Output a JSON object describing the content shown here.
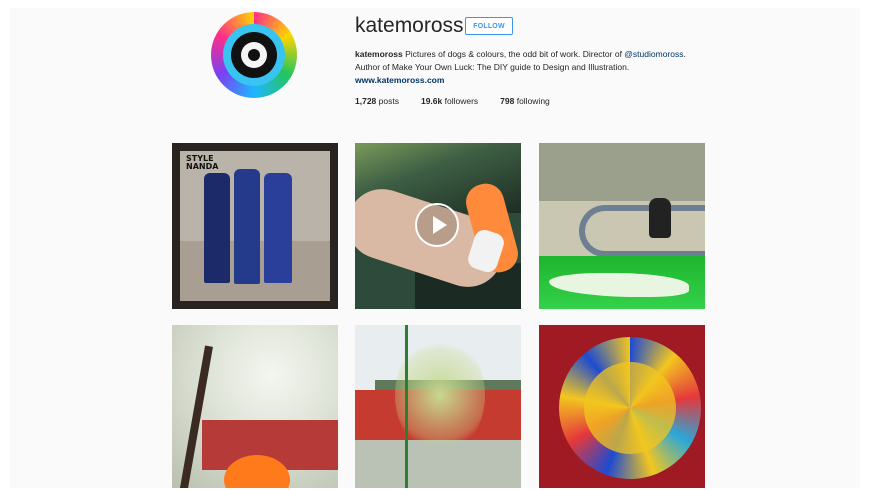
{
  "profile": {
    "username": "katemoross",
    "follow_label": "FOLLOW",
    "bio": {
      "name": "katemoross",
      "text1": " Pictures of dogs & colours, the odd bit of work. Director of ",
      "mention": "@studiomoross",
      "text2": ". Author of Make Your Own Luck: The DIY guide to Design and Illustration. ",
      "website": "www.katemoross.com"
    },
    "stats": {
      "posts_count": "1,728",
      "posts_label": " posts",
      "followers_count": "19.6k",
      "followers_label": " followers",
      "following_count": "798",
      "following_label": " following"
    }
  },
  "grid": {
    "tile1_brand_line1": "STYLE",
    "tile1_brand_line2": "NANDA"
  },
  "colors": {
    "accent": "#3897f0",
    "link": "#003569",
    "background": "#fafafa"
  },
  "icons": {
    "play": "play-icon"
  }
}
